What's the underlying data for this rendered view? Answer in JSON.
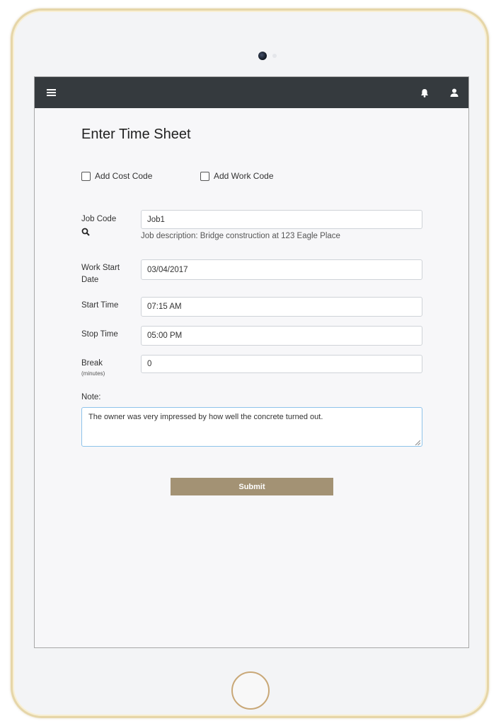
{
  "app": {
    "title": "Enter Time Sheet"
  },
  "topbar": {
    "menu_icon": "menu-icon",
    "notifications_icon": "bell-icon",
    "account_icon": "user-icon",
    "background": "#353a3e"
  },
  "options": {
    "add_cost_code": {
      "label": "Add Cost Code",
      "checked": false
    },
    "add_work_code": {
      "label": "Add Work Code",
      "checked": false
    }
  },
  "form": {
    "job_code": {
      "label": "Job Code",
      "value": "Job1",
      "search_icon": "search-icon",
      "description": "Job description: Bridge construction at 123 Eagle Place"
    },
    "work_start_date": {
      "label_line1": "Work Start",
      "label_line2": "Date",
      "value": "03/04/2017"
    },
    "start_time": {
      "label": "Start Time",
      "value": "07:15 AM"
    },
    "stop_time": {
      "label": "Stop Time",
      "value": "05:00 PM"
    },
    "break": {
      "label": "Break",
      "hint": "(minutes)",
      "value": "0"
    },
    "note": {
      "label": "Note:",
      "value": "The owner was very impressed by how well the concrete turned out."
    }
  },
  "submit": {
    "label": "Submit",
    "color": "#a39274"
  },
  "device": {
    "frame_color": "#e6d6a8",
    "home_button_color": "#c9a877"
  }
}
